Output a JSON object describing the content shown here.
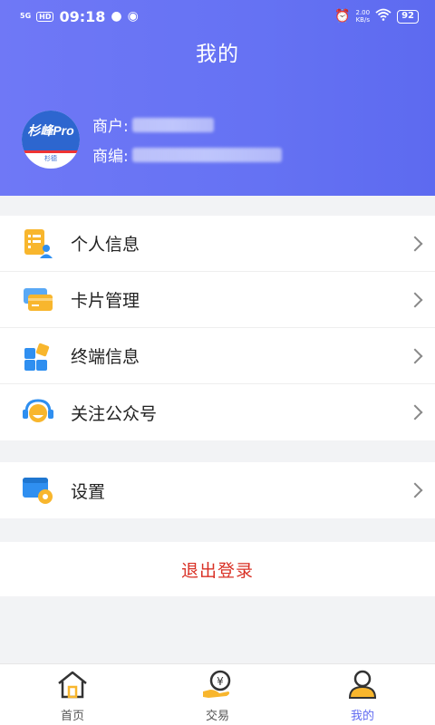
{
  "status_bar": {
    "signal": "5G",
    "hd": "HD",
    "time": "09:18",
    "net_rate": "2.00",
    "net_unit": "KB/s",
    "battery": "92"
  },
  "header": {
    "title": "我的",
    "avatar_text": "杉峰Pro",
    "avatar_sub": "杉德",
    "merchant_label": "商户:",
    "merchant_no_label": "商编:"
  },
  "menu": {
    "group1": [
      {
        "label": "个人信息",
        "icon": "personal-info-icon"
      },
      {
        "label": "卡片管理",
        "icon": "card-icon"
      },
      {
        "label": "终端信息",
        "icon": "terminal-icon"
      },
      {
        "label": "关注公众号",
        "icon": "follow-icon"
      }
    ],
    "group2": [
      {
        "label": "设置",
        "icon": "settings-icon"
      }
    ]
  },
  "logout_label": "退出登录",
  "tabs": [
    {
      "label": "首页",
      "icon": "home-icon"
    },
    {
      "label": "交易",
      "icon": "transaction-icon"
    },
    {
      "label": "我的",
      "icon": "profile-icon"
    }
  ],
  "colors": {
    "header": "#6572f3",
    "accent": "#5f6af1",
    "logout": "#d93025",
    "icon_yellow": "#f8b62d",
    "icon_blue": "#2f8ff0"
  }
}
